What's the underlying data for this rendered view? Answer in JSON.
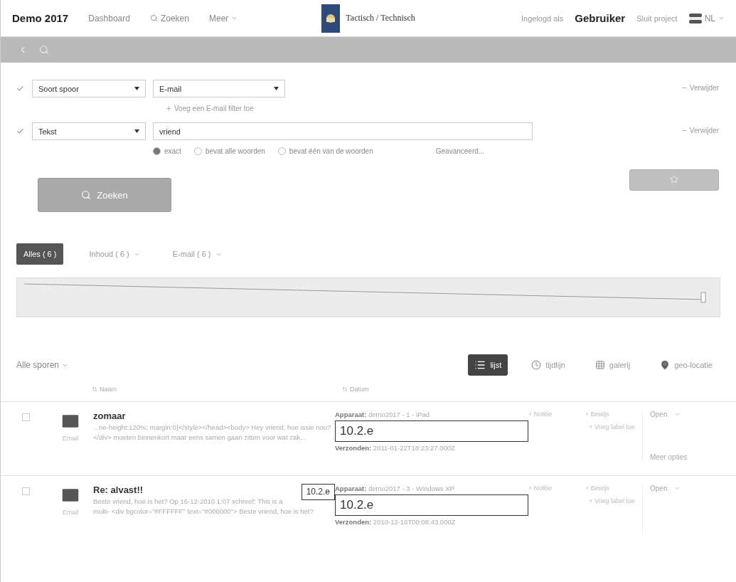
{
  "header": {
    "brand": "Demo 2017",
    "nav": [
      {
        "label": "Dashboard",
        "kind": "link"
      },
      {
        "label": "Zoeken",
        "kind": "search"
      },
      {
        "label": "Meer",
        "kind": "menu"
      }
    ],
    "center_title": "Tactisch / Technisch",
    "login_prefix": "Ingelogd als",
    "user": "Gebruiker",
    "close_project": "Sluit project",
    "language": "NL"
  },
  "filters": [
    {
      "checked": true,
      "field": "Soort spoor",
      "kind": "select",
      "value": "E-mail",
      "add_link": "Voeg een E-mail filter toe",
      "remove": "Verwijder"
    },
    {
      "checked": true,
      "field": "Tekst",
      "kind": "text",
      "value": "vriend",
      "remove": "Verwijder",
      "options": [
        {
          "label": "exact",
          "selected": true
        },
        {
          "label": "bevat alle woorden",
          "selected": false
        },
        {
          "label": "bevat één van de woorden",
          "selected": false
        }
      ],
      "advanced": "Geavanceerd..."
    }
  ],
  "search_button": "Zoeken",
  "result_tabs": [
    {
      "label": "Alles ( 6 )",
      "selected": true,
      "dropdown": false
    },
    {
      "label": "Inhoud ( 6 )",
      "selected": false,
      "dropdown": true
    },
    {
      "label": "E-mail ( 6 )",
      "selected": false,
      "dropdown": true
    }
  ],
  "trace_filter": "Alle sporen",
  "views": [
    {
      "label": "lijst",
      "selected": true
    },
    {
      "label": "tijdlijn",
      "selected": false
    },
    {
      "label": "galerij",
      "selected": false
    },
    {
      "label": "geo-locatie",
      "selected": false
    }
  ],
  "columns": [
    "Naam",
    "Datum"
  ],
  "rows": [
    {
      "checked": false,
      "type_label": "Email",
      "title": "zomaar",
      "snippet": "...ne-height:120%; margin:0}</style></head><body> Hey vriend, hoe issie nou? </div> moeten binnenkort maar eens samen gaan zitten voor wat zak...",
      "snippet_redaction": null,
      "device_label": "Apparaat:",
      "device": "demo2017 - 1 - iPad",
      "redaction": "10.2.e",
      "sent_label": "Verzonden:",
      "sent": "2011-01-22T18:23:27.000Z",
      "note": "+ Notitie",
      "evidence": "+ Bewijs",
      "add_label": "+ Voeg label toe",
      "open": "Open",
      "more": "Meer opties"
    },
    {
      "checked": false,
      "type_label": "Email",
      "title": "Re: alvast!!",
      "snippet": "Beste vriend, hoe is het? Op 16-12-2010 1:07 schreef: This is a multi- <div bgcolor=\"#FFFFFF\" text=\"#000000\"> Beste vriend, hoe is het?",
      "snippet_redaction": "10.2.e",
      "device_label": "Apparaat:",
      "device": "demo2017 - 3 - Windows XP",
      "redaction": "10.2.e",
      "sent_label": "Verzonden:",
      "sent": "2010-12-16T00:08:43.000Z",
      "note": "+ Notitie",
      "evidence": "+ Bewijs",
      "add_label": "+ Voeg label toe",
      "open": "Open"
    }
  ]
}
